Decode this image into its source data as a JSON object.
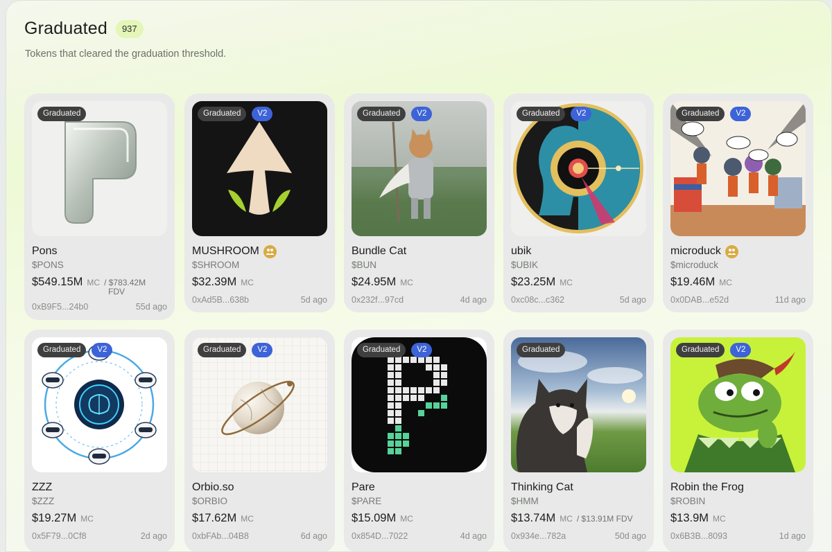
{
  "header": {
    "title": "Graduated",
    "count": "937",
    "subtitle": "Tokens that cleared the graduation threshold."
  },
  "labels": {
    "graduated": "Graduated",
    "v2": "V2",
    "mc": "MC"
  },
  "colors": {
    "accent_green": "#e4f6b8",
    "v2_blue": "#3d63d8",
    "graduated_badge": "#3f3f3f",
    "community_gold": "#d9aa43"
  },
  "tokens": [
    {
      "name": "Pons",
      "ticker": "$PONS",
      "mc": "$549.15M",
      "fdv_prefix": "/ $783.42M",
      "fdv_suffix": "FDV",
      "address": "0xB9F5...24b0",
      "age": "55d ago",
      "v2": false,
      "community": false,
      "image": "pons-logo"
    },
    {
      "name": "MUSHROOM",
      "ticker": "$SHROOM",
      "mc": "$32.39M",
      "address": "0xAd5B...638b",
      "age": "5d ago",
      "v2": true,
      "community": true,
      "image": "mushroom-logo"
    },
    {
      "name": "Bundle Cat",
      "ticker": "$BUN",
      "mc": "$24.95M",
      "address": "0x232f...97cd",
      "age": "4d ago",
      "v2": true,
      "community": false,
      "image": "knight-cat-photo"
    },
    {
      "name": "ubik",
      "ticker": "$UBIK",
      "mc": "$23.25M",
      "address": "0xc08c...c362",
      "age": "5d ago",
      "v2": true,
      "community": false,
      "image": "ubik-head-logo"
    },
    {
      "name": "microduck",
      "ticker": "$microduck",
      "mc": "$19.46M",
      "address": "0x0DAB...e52d",
      "age": "11d ago",
      "v2": true,
      "community": true,
      "image": "microduck-comic"
    },
    {
      "name": "ZZZ",
      "ticker": "$ZZZ",
      "mc": "$19.27M",
      "address": "0x5F79...0Cf8",
      "age": "2d ago",
      "v2": true,
      "community": false,
      "image": "zzz-brain-robots"
    },
    {
      "name": "Orbio.so",
      "ticker": "$ORBIO",
      "mc": "$17.62M",
      "address": "0xbFAb...04B8",
      "age": "6d ago",
      "v2": true,
      "community": false,
      "image": "orbio-marble-planet"
    },
    {
      "name": "Pare",
      "ticker": "$PARE",
      "mc": "$15.09M",
      "address": "0x854D...7022",
      "age": "4d ago",
      "v2": true,
      "community": false,
      "image": "pare-pixel-logo"
    },
    {
      "name": "Thinking Cat",
      "ticker": "$HMM",
      "mc": "$13.74M",
      "fdv_inline": "/ $13.91M FDV",
      "address": "0x934e...782a",
      "age": "50d ago",
      "v2": false,
      "community": false,
      "image": "thinking-cat-photo"
    },
    {
      "name": "Robin the Frog",
      "ticker": "$ROBIN",
      "mc": "$13.9M",
      "address": "0x6B3B...8093",
      "age": "1d ago",
      "v2": true,
      "community": false,
      "image": "robin-frog-art"
    }
  ]
}
